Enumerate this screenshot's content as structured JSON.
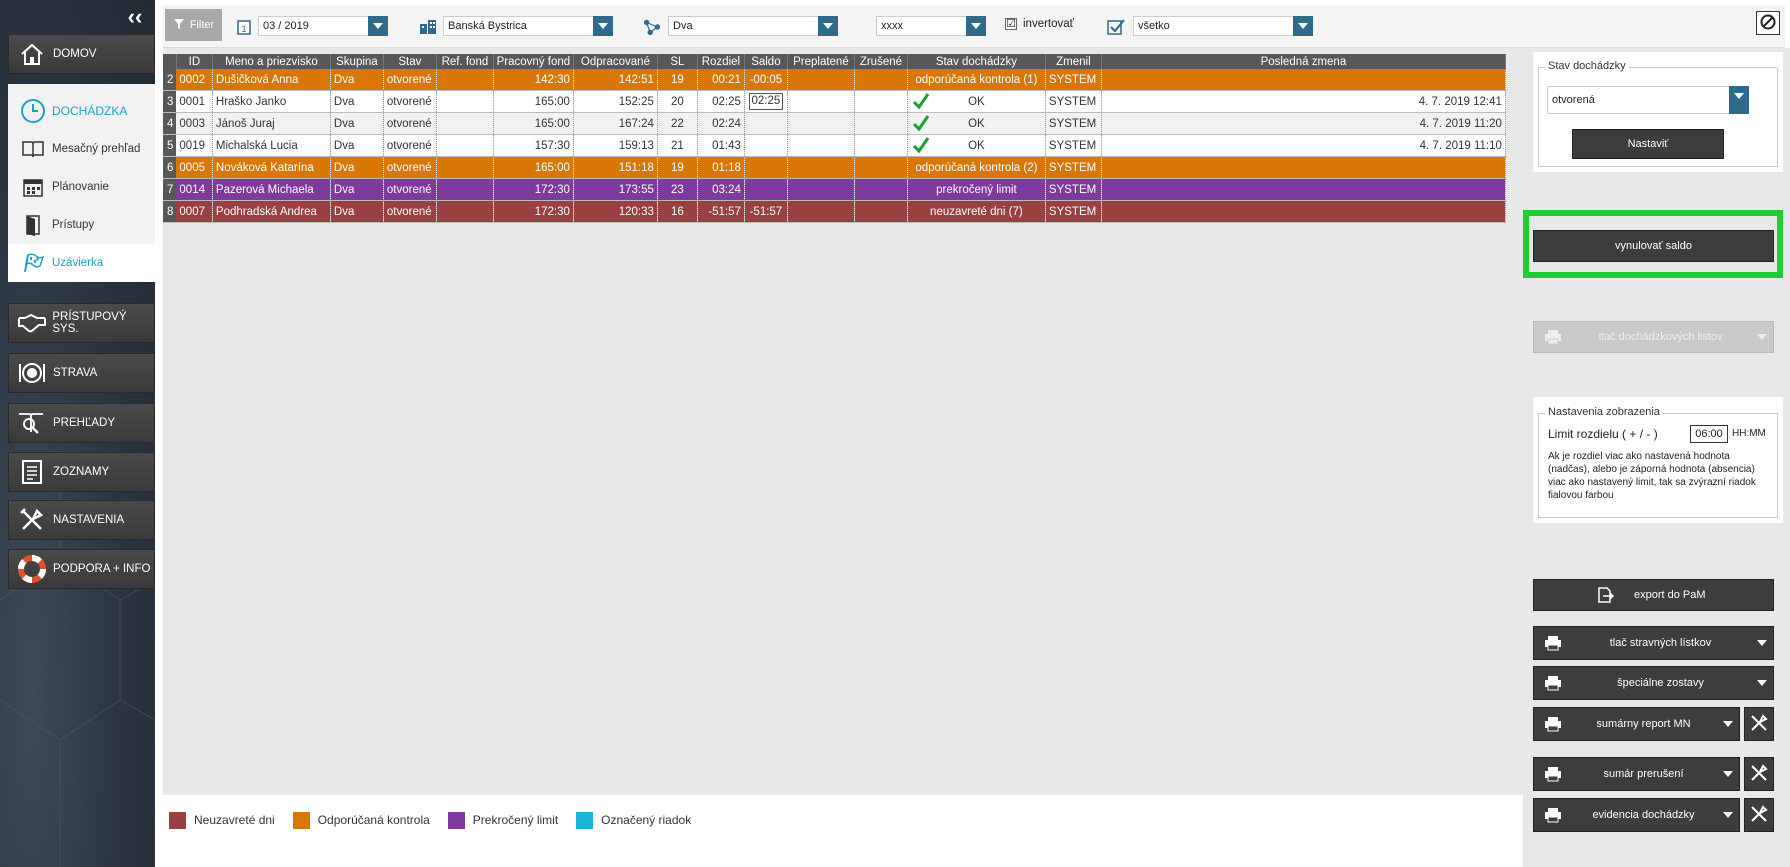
{
  "sidebar": {
    "collapse_icon": "chevron-left-icon",
    "top": [
      {
        "label": "DOMOV",
        "icon": "home-icon"
      }
    ],
    "section_head": {
      "label": "DOCHÁDZKA",
      "icon": "clock-icon"
    },
    "sub_items": [
      {
        "label": "Mesačný prehľad",
        "icon": "book-icon"
      },
      {
        "label": "Plánovanie",
        "icon": "calendar-icon"
      },
      {
        "label": "Prístupy",
        "icon": "door-icon"
      },
      {
        "label": "Uzávierka",
        "icon": "flag-icon"
      }
    ],
    "bottom": [
      {
        "label": "PRÍSTUPOVÝ SYS.",
        "icon": "handshake-icon"
      },
      {
        "label": "STRAVA",
        "icon": "plate-icon"
      },
      {
        "label": "PREHĽADY",
        "icon": "magnifier-book-icon"
      },
      {
        "label": "ZOZNAMY",
        "icon": "list-icon"
      },
      {
        "label": "NASTAVENIA",
        "icon": "tools-icon"
      },
      {
        "label": "PODPORA + INFO",
        "icon": "lifebuoy-icon"
      }
    ]
  },
  "toolbar": {
    "filter_label": "Filter",
    "period": "03 / 2019",
    "location": "Banská Bystrica",
    "group": "Dva",
    "code": "xxxx",
    "invert_label": "invertovať",
    "invert_checked": "☑",
    "scope": "všetko"
  },
  "grid": {
    "headers": [
      "ID",
      "Meno a priezvisko",
      "Skupina",
      "Stav",
      "Ref. fond",
      "Pracovný fond",
      "Odpracované",
      "SL",
      "Rozdiel",
      "Saldo",
      "Preplatené",
      "Zrušené",
      "Stav dochádzky",
      "Zmenil",
      "Posledná zmena"
    ],
    "rows": [
      {
        "n": "2",
        "id": "0002",
        "name": "Dušičková Anna",
        "group": "Dva",
        "state": "otvorené",
        "ref": "",
        "fund": "142:30",
        "worked": "142:51",
        "sl": "19",
        "diff": "00:21",
        "saldo": "-00:05",
        "paid": "",
        "cancel": "",
        "att": "odporúčaná kontrola (1)",
        "check": false,
        "by": "SYSTEM",
        "last": "",
        "style": "orange"
      },
      {
        "n": "3",
        "id": "0001",
        "name": "Hraško Janko",
        "group": "Dva",
        "state": "otvorené",
        "ref": "",
        "fund": "165:00",
        "worked": "152:25",
        "sl": "20",
        "diff": "02:25",
        "saldo": "02:25",
        "paid": "",
        "cancel": "",
        "att": "OK",
        "check": true,
        "by": "SYSTEM",
        "last": "4. 7. 2019 12:41",
        "style": "white",
        "saldo_box": true
      },
      {
        "n": "4",
        "id": "0003",
        "name": "Jánoš Juraj",
        "group": "Dva",
        "state": "otvorené",
        "ref": "",
        "fund": "165:00",
        "worked": "167:24",
        "sl": "22",
        "diff": "02:24",
        "saldo": "",
        "paid": "",
        "cancel": "",
        "att": "OK",
        "check": true,
        "by": "SYSTEM",
        "last": "4. 7. 2019 11:20",
        "style": "grey"
      },
      {
        "n": "5",
        "id": "0019",
        "name": "Michalská Lucia",
        "group": "Dva",
        "state": "otvorené",
        "ref": "",
        "fund": "157:30",
        "worked": "159:13",
        "sl": "21",
        "diff": "01:43",
        "saldo": "",
        "paid": "",
        "cancel": "",
        "att": "OK",
        "check": true,
        "by": "SYSTEM",
        "last": "4. 7. 2019 11:10",
        "style": "white"
      },
      {
        "n": "6",
        "id": "0005",
        "name": "Nováková Katarína",
        "group": "Dva",
        "state": "otvorené",
        "ref": "",
        "fund": "165:00",
        "worked": "151:18",
        "sl": "19",
        "diff": "01:18",
        "saldo": "",
        "paid": "",
        "cancel": "",
        "att": "odporúčaná kontrola (2)",
        "check": false,
        "by": "SYSTEM",
        "last": "",
        "style": "orange"
      },
      {
        "n": "7",
        "id": "0014",
        "name": "Pazerová Michaela",
        "group": "Dva",
        "state": "otvorené",
        "ref": "",
        "fund": "172:30",
        "worked": "173:55",
        "sl": "23",
        "diff": "03:24",
        "saldo": "",
        "paid": "",
        "cancel": "",
        "att": "prekročený limit",
        "check": false,
        "by": "SYSTEM",
        "last": "",
        "style": "purple"
      },
      {
        "n": "8",
        "id": "0007",
        "name": "Podhradská Andrea",
        "group": "Dva",
        "state": "otvorené",
        "ref": "",
        "fund": "172:30",
        "worked": "120:33",
        "sl": "16",
        "diff": "-51:57",
        "saldo": "-51:57",
        "paid": "",
        "cancel": "",
        "att": "neuzavreté dni (7)",
        "check": false,
        "by": "SYSTEM",
        "last": "",
        "style": "red"
      }
    ]
  },
  "legend": [
    {
      "label": "Neuzavreté dni",
      "color": "#9a4040"
    },
    {
      "label": "Odporúčaná kontrola",
      "color": "#d97706"
    },
    {
      "label": "Prekročený limit",
      "color": "#7e3a9c"
    },
    {
      "label": "Označený riadok",
      "color": "#1ab2d6"
    }
  ],
  "right": {
    "state_title": "Stav dochádzky",
    "state_value": "otvorená",
    "set_label": "Nastaviť",
    "reset_label": "vynulovať saldo",
    "print_sheets_label": "tlač dochádzkových listov",
    "display_title": "Nastavenia zobrazenia",
    "limit_label": "Limit rozdielu ( + / - )",
    "limit_value": "06:00",
    "limit_unit": "HH:MM",
    "limit_help": "Ak je rozdiel viac ako nastavená hodnota (nadčas), alebo je záporná hodnota (absencia) viac ako nastavený limit, tak sa zvýrazní riadok fialovou farbou",
    "export_label": "export do PaM",
    "buttons": [
      {
        "label": "tlač stravných lístkov",
        "tool": false
      },
      {
        "label": "špeciálne zostavy",
        "tool": false
      },
      {
        "label": "sumárny report MN",
        "tool": true
      },
      {
        "label": "sumár prerušení",
        "tool": true
      },
      {
        "label": "evidencia dochádzky",
        "tool": true
      }
    ]
  },
  "colors": {
    "accent": "#1aa3c4",
    "highlight": "#22cc33",
    "dark": "#3d3d3d"
  }
}
